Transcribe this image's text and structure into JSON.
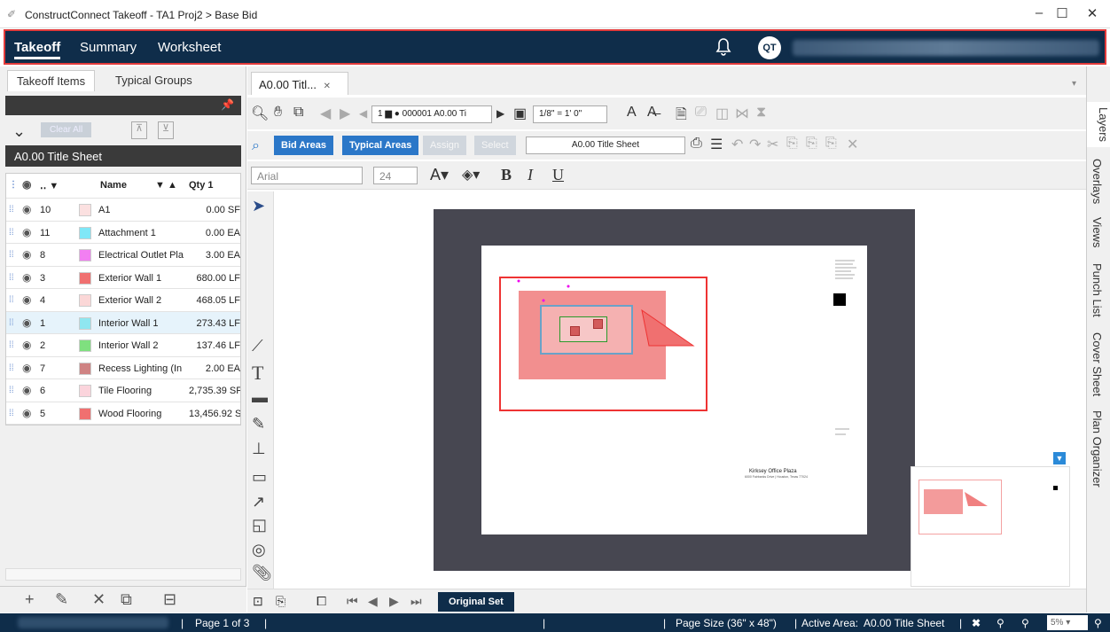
{
  "window": {
    "title": "ConstructConnect Takeoff - TA1 Proj2 > Base Bid",
    "minimize": "–",
    "maximize": "☐",
    "close": "✕"
  },
  "nav": {
    "items": [
      "Takeoff",
      "Summary",
      "Worksheet"
    ],
    "avatar": "QT"
  },
  "left_panel": {
    "tabs": [
      "Takeoff Items",
      "Typical Groups"
    ],
    "clear_all": "Clear All",
    "sheet_title": "A0.00 Title Sheet",
    "columns": [
      "Name",
      "Qty 1"
    ],
    "rows": [
      {
        "num": "10",
        "name": "A1",
        "qty": "0.00 SF",
        "color": "#fbe0e0"
      },
      {
        "num": "11",
        "name": "Attachment 1",
        "qty": "0.00 EA",
        "color": "#7fe7f7"
      },
      {
        "num": "8",
        "name": "Electrical Outlet Pla",
        "qty": "3.00 EA",
        "color": "#f27ff2"
      },
      {
        "num": "3",
        "name": "Exterior Wall 1",
        "qty": "680.00 LF",
        "color": "#f07070"
      },
      {
        "num": "4",
        "name": "Exterior Wall 2",
        "qty": "468.05 LF",
        "color": "#fbd7d7"
      },
      {
        "num": "1",
        "name": "Interior Wall 1",
        "qty": "273.43 LF",
        "color": "#8fe6f0"
      },
      {
        "num": "2",
        "name": "Interior Wall 2",
        "qty": "137.46 LF",
        "color": "#7fe07f"
      },
      {
        "num": "7",
        "name": "Recess Lighting (In",
        "qty": "2.00 EA",
        "color": "#cf8383"
      },
      {
        "num": "6",
        "name": "Tile Flooring",
        "qty": "2,735.39 SF",
        "color": "#fbd4dc"
      },
      {
        "num": "5",
        "name": "Wood Flooring",
        "qty": "13,456.92 SF",
        "color": "#f07070"
      }
    ],
    "selected_row_index": 5
  },
  "doc": {
    "tab_label": "A0.00 Titl...",
    "page_combo": "1 ▆ ● 000001 A0.00 Ti",
    "scale_combo": "1/8\" = 1' 0\"",
    "bid_areas": "Bid Areas",
    "typical_areas": "Typical Areas",
    "assign": "Assign",
    "select": "Select",
    "area_combo": "A0.00 Title Sheet",
    "font_combo": "Arial",
    "size_combo": "24",
    "drawing_title": "Kirksey Office Plaza",
    "drawing_subtitle": "6000 Fairbanks Drive | Houston, Texas 77024"
  },
  "right_rail": [
    "Layers",
    "Overlays",
    "Views",
    "Punch List",
    "Cover Sheet",
    "Plan Organizer"
  ],
  "page_bar": {
    "original_set": "Original Set"
  },
  "status": {
    "page": "Page 1 of 3",
    "page_size": "Page Size (36\" x 48\")",
    "active_area_label": "Active Area:",
    "active_area": "A0.00 Title Sheet",
    "zoom": "5%"
  }
}
